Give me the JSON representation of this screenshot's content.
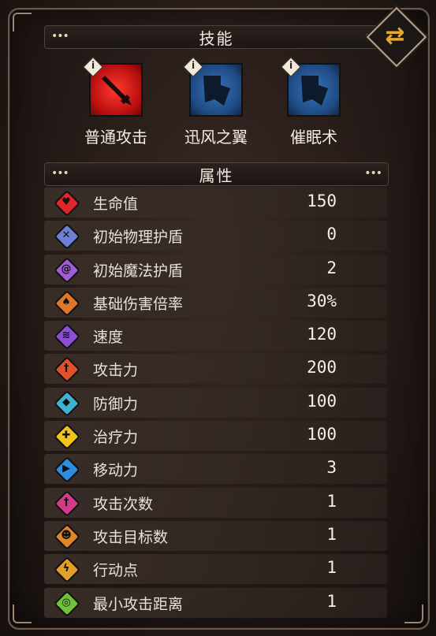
{
  "skills_header": {
    "title": "技能",
    "dots_left": "•••",
    "dots_right": "•••"
  },
  "swap_button": {
    "icon": "swap-arrows-icon",
    "glyph": "⇄"
  },
  "skills": [
    {
      "label": "普通攻击",
      "icon": "sword-icon",
      "color": "#d11a14",
      "badge": "i"
    },
    {
      "label": "迅风之翼",
      "icon": "shield-icon",
      "color": "#2b5e9c",
      "badge": "i"
    },
    {
      "label": "催眠术",
      "icon": "shield-icon",
      "color": "#2b5e9c",
      "badge": "i"
    }
  ],
  "attrs_header": {
    "title": "属性",
    "dots_left": "•••",
    "dots_right": "•••"
  },
  "attributes": [
    {
      "name": "生命值",
      "value": "150",
      "icon": "heart-icon",
      "color": "#e0262b",
      "glyph": "♥"
    },
    {
      "name": "初始物理护盾",
      "value": "0",
      "icon": "physical-shield-icon",
      "color": "#6d7fd6",
      "glyph": "✕"
    },
    {
      "name": "初始魔法护盾",
      "value": "2",
      "icon": "magic-shield-icon",
      "color": "#a25cd6",
      "glyph": "@"
    },
    {
      "name": "基础伤害倍率",
      "value": "30%",
      "icon": "axe-icon",
      "color": "#e0762a",
      "glyph": "♠"
    },
    {
      "name": "速度",
      "value": "120",
      "icon": "speed-icon",
      "color": "#8a4fd6",
      "glyph": "≋"
    },
    {
      "name": "攻击力",
      "value": "200",
      "icon": "attack-icon",
      "color": "#e0502a",
      "glyph": "†"
    },
    {
      "name": "防御力",
      "value": "100",
      "icon": "armor-icon",
      "color": "#3fb2cf",
      "glyph": "◆"
    },
    {
      "name": "治疗力",
      "value": "100",
      "icon": "heal-icon",
      "color": "#f2c21d",
      "glyph": "✚"
    },
    {
      "name": "移动力",
      "value": "3",
      "icon": "boot-icon",
      "color": "#2f8de0",
      "glyph": "▶"
    },
    {
      "name": "攻击次数",
      "value": "1",
      "icon": "attack-count-icon",
      "color": "#d23a8a",
      "glyph": "†"
    },
    {
      "name": "攻击目标数",
      "value": "1",
      "icon": "target-count-icon",
      "color": "#e0862a",
      "glyph": "☻"
    },
    {
      "name": "行动点",
      "value": "1",
      "icon": "action-point-icon",
      "color": "#e0a02a",
      "glyph": "ϟ"
    },
    {
      "name": "最小攻击距离",
      "value": "1",
      "icon": "range-icon",
      "color": "#6fc23a",
      "glyph": "◎"
    }
  ]
}
